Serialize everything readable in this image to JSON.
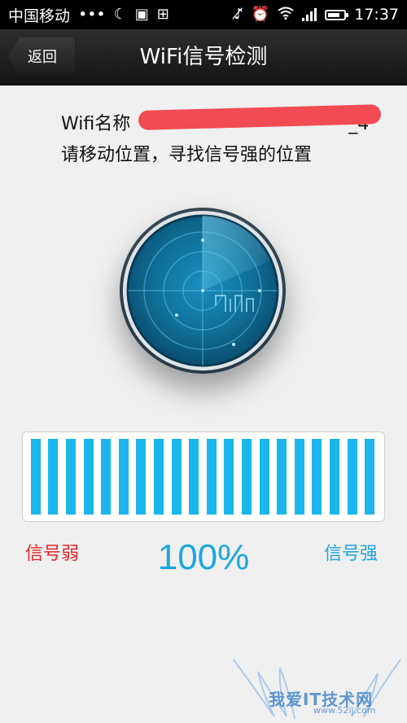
{
  "status_bar": {
    "carrier": "中国移动",
    "dots": "•••",
    "time": "17:37",
    "battery_level": 0.8
  },
  "header": {
    "back_label": "返回",
    "title": "WiFi信号检测"
  },
  "content": {
    "wifi_name_label": "Wifi名称",
    "wifi_name_suffix": "_4",
    "instruction": "请移动位置，寻找信号强的位置"
  },
  "signal": {
    "weak_label": "信号弱",
    "strong_label": "信号强",
    "percent": "100%",
    "level": 1.0,
    "bar_count": 20
  },
  "watermark": {
    "text": "我爱IT技术网",
    "url": "www.52ij.com"
  },
  "colors": {
    "accent": "#1bb6ec",
    "weak": "#e2262b",
    "redaction": "#f24b54"
  }
}
